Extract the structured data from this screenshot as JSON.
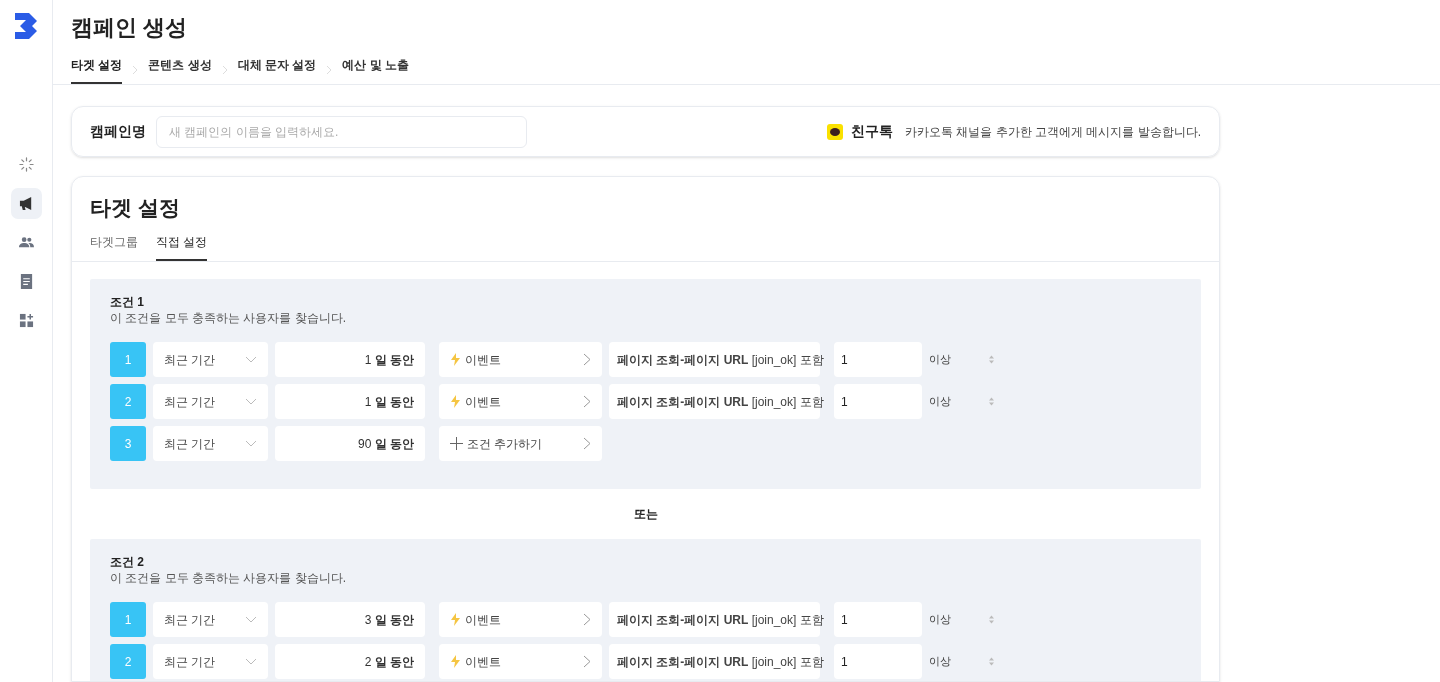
{
  "sidebar": {
    "items": [
      {
        "kind": "loading",
        "selected": false
      },
      {
        "kind": "megaphone",
        "selected": true
      },
      {
        "kind": "people",
        "selected": false
      },
      {
        "kind": "document",
        "selected": false
      },
      {
        "kind": "widgets",
        "selected": false
      }
    ]
  },
  "header": {
    "title": "캠페인 생성",
    "steps": [
      {
        "label": "타겟 설정",
        "selected": true
      },
      {
        "label": "콘텐츠 생성",
        "selected": false
      },
      {
        "label": "대체 문자 설정",
        "selected": false
      },
      {
        "label": "예산 및 노출",
        "selected": false
      }
    ]
  },
  "campaign": {
    "label": "캠페인명",
    "placeholder": "새 캠페인의 이름을 입력하세요.",
    "channel": "친구톡",
    "channel_description": "카카오톡 채널을 추가한 고객에게 메시지를 발송합니다."
  },
  "target": {
    "title": "타겟 설정",
    "tabs": [
      {
        "label": "타겟그룹",
        "selected": false
      },
      {
        "label": "직접 설정",
        "selected": true
      }
    ],
    "groups": [
      {
        "title": "조건 1",
        "description": "이 조건을 모두 충족하는 사용자를 찾습니다.",
        "rows": [
          {
            "kind": "event",
            "number": "1",
            "period": "최근 기간",
            "days": "1 **일 동안**",
            "event": "이벤트",
            "filter": "**페이지 조회-페이지 URL** [join_ok] 포함",
            "count": "1",
            "comparison": "이상"
          },
          {
            "kind": "event",
            "number": "2",
            "period": "최근 기간",
            "days": "1 **일 동안**",
            "event": "이벤트",
            "filter": "**페이지 조회-페이지 URL** [join_ok] 포함",
            "count": "1",
            "comparison": "이상"
          },
          {
            "kind": "add",
            "number": "3",
            "period": "최근 기간",
            "days": "90 **일 동안**",
            "event": "조건 추가하기"
          }
        ]
      },
      {
        "title": "조건 2",
        "description": "이 조건을 모두 충족하는 사용자를 찾습니다.",
        "rows": [
          {
            "kind": "event",
            "number": "1",
            "period": "최근 기간",
            "days": "3 **일 동안**",
            "event": "이벤트",
            "filter": "**페이지 조회-페이지 URL** [join_ok] 포함",
            "count": "1",
            "comparison": "이상"
          },
          {
            "kind": "event",
            "number": "2",
            "period": "최근 기간",
            "days": "2 **일 동안**",
            "event": "이벤트",
            "filter": "**페이지 조회-페이지 URL** [join_ok] 포함",
            "count": "1",
            "comparison": "이상"
          }
        ]
      }
    ],
    "separator": "또는"
  }
}
